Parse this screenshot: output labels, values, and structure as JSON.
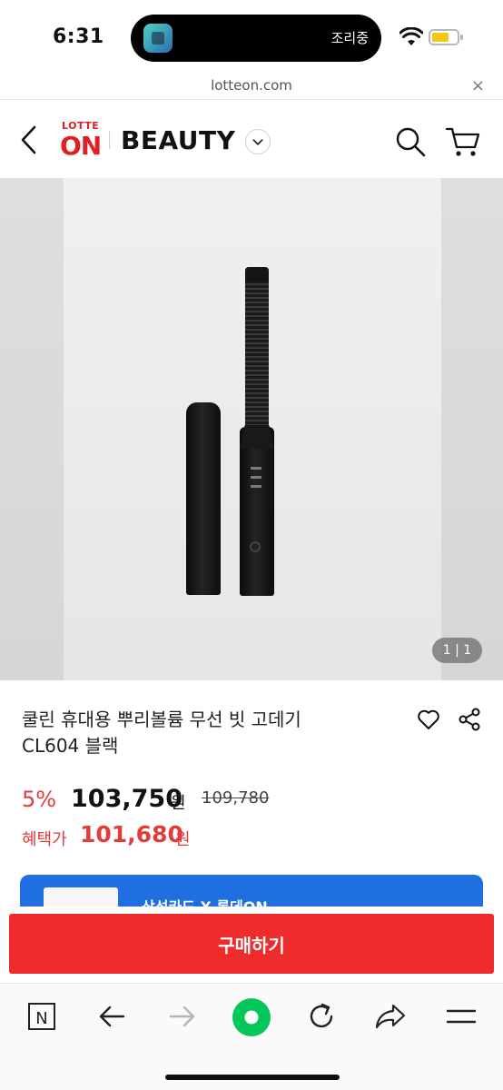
{
  "status_bar": {
    "time": "6:31",
    "activity_text": "조리중",
    "battery_color": "#f5c518"
  },
  "browser": {
    "url": "lotteon.com",
    "close_label": "×"
  },
  "header": {
    "logo_top": "LOTTE",
    "logo_bottom": "ON",
    "brand_title": "BEAUTY",
    "back_icon": "chevron-left-icon",
    "search_icon": "search-icon",
    "cart_icon": "cart-icon",
    "accent_color": "#e02020"
  },
  "gallery": {
    "counter": "1 | 1"
  },
  "product": {
    "title_line1": "쿨린 휴대용 뿌리볼륨 무선 빗 고데기",
    "title_line2": "CL604 블랙",
    "discount": "5%",
    "price": "103,750",
    "price_unit": "원",
    "original_price": "109,780",
    "benefit_label": "혜택가",
    "benefit_price": "101,680",
    "benefit_unit": "원",
    "price_color": "#e33a3a"
  },
  "promo_banner": {
    "text": "삼성카드 X 롯데ON",
    "color": "#1f6fe0"
  },
  "purchase": {
    "buy_label": "구매하기",
    "button_color": "#ef2b2b"
  },
  "toolbar": {
    "items": [
      "naver-icon",
      "back-arrow-icon",
      "forward-arrow-icon",
      "green-dot-home-icon",
      "reload-icon",
      "share-icon",
      "menu-icon"
    ],
    "naver_label": "N",
    "green_color": "#03c75a"
  }
}
